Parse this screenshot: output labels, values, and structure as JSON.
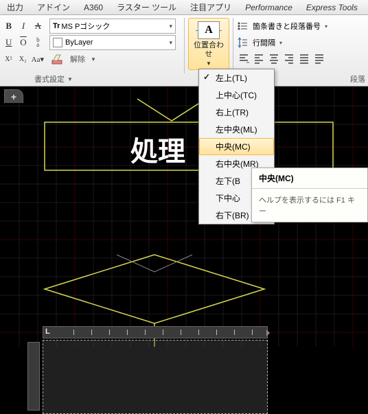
{
  "menubar": [
    "出力",
    "アドイン",
    "A360",
    "ラスター ツール",
    "注目アプリ",
    "Performance",
    "Express Tools"
  ],
  "font": {
    "name": "MS Pゴシック",
    "layer": "ByLayer",
    "release_label": "解除"
  },
  "panel": {
    "style_label": "書式設定",
    "align_label": "位置合わせ",
    "para_label": "段落"
  },
  "paragraph": {
    "bullets": "箇条書きと段落番号",
    "linespace": "行間隔"
  },
  "align_menu": {
    "items": [
      {
        "label": "左上(TL)",
        "checked": true
      },
      {
        "label": "上中心(TC)"
      },
      {
        "label": "右上(TR)"
      },
      {
        "label": "左中央(ML)"
      },
      {
        "label": "中央(MC)",
        "hl": true
      },
      {
        "label": "右中央(MR)"
      },
      {
        "label": "左下(BL)",
        "trunc": "左下(B"
      },
      {
        "label": "下中心(BC)",
        "trunc": "下中心"
      },
      {
        "label": "右下(BR)",
        "trunc": "右下(BR)"
      }
    ]
  },
  "tooltip": {
    "title": "中央(MC)",
    "help": "ヘルプを表示するには F1 キー"
  },
  "canvas": {
    "text": "処理",
    "tab": "+"
  },
  "ruler": {
    "marker": "L"
  }
}
